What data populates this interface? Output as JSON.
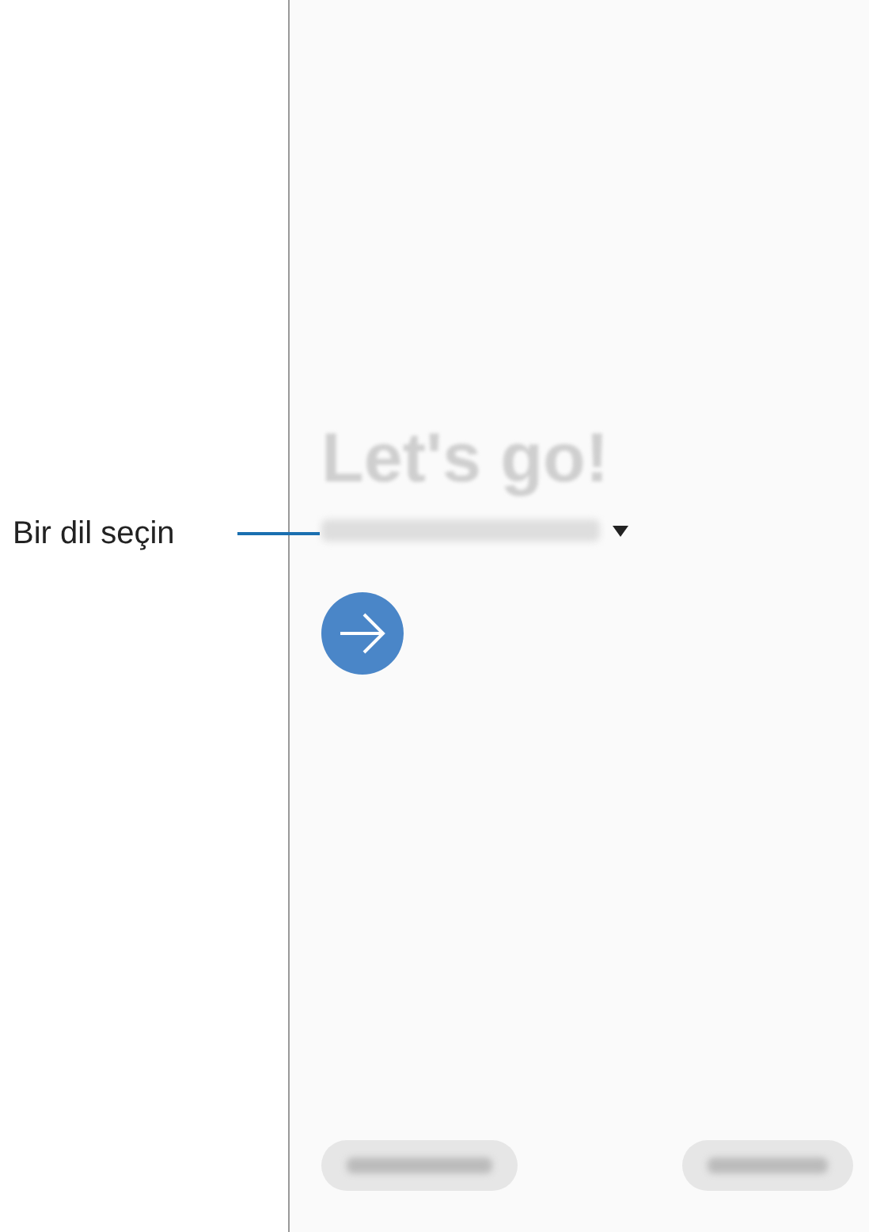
{
  "callout": {
    "label": "Bir dil seçin"
  },
  "screen": {
    "title": "Let's go!"
  }
}
